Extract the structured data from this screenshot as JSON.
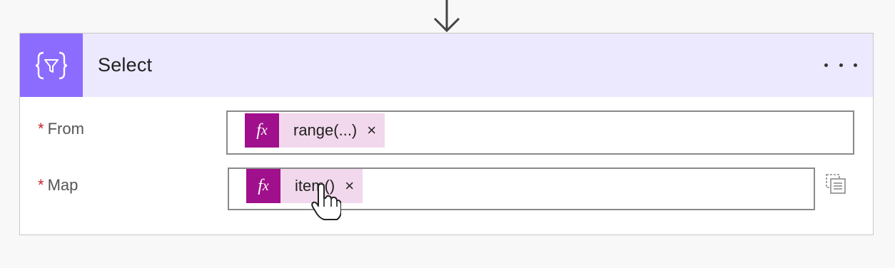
{
  "action": {
    "title": "Select",
    "header_color": "#ece8fd",
    "icon_bg": "#8c6cff",
    "icon": "filter-braces-icon",
    "menu_icon": "more-options-icon"
  },
  "fields": {
    "from": {
      "required_mark": "*",
      "label": "From",
      "token": {
        "icon": "fx-icon",
        "icon_text": "fx",
        "label": "range(...)",
        "remove": "×"
      }
    },
    "map": {
      "required_mark": "*",
      "label": "Map",
      "token": {
        "icon": "fx-icon",
        "icon_text": "fx",
        "label": "item()",
        "remove": "×"
      },
      "side_icon": "switch-to-text-mode-icon"
    }
  },
  "colors": {
    "token_bg": "#f2d8ec",
    "fx_bg": "#a0108c",
    "required": "#c4262e"
  }
}
